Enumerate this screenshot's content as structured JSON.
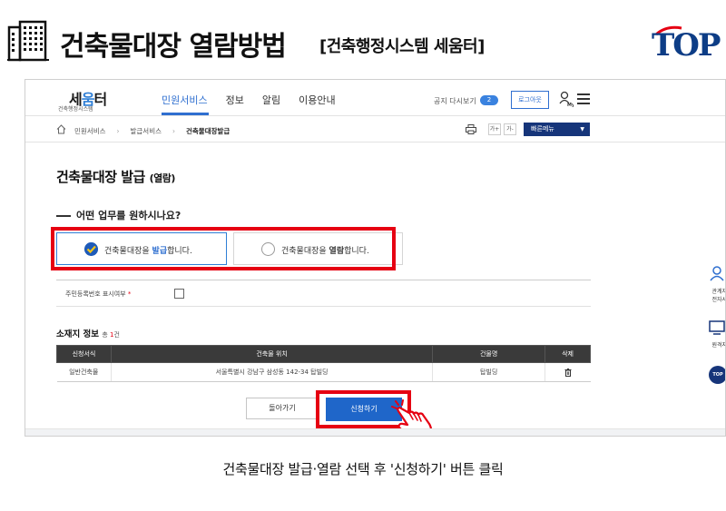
{
  "guide": {
    "title": "건축물대장 열람방법",
    "subtitle": "[건축행정시스템 세움터]",
    "brand": "TOP",
    "caption": "건축물대장 발급·열람 선택 후 '신청하기' 버튼 클릭"
  },
  "site": {
    "logo_main_a": "세",
    "logo_main_b": "움",
    "logo_main_c": "터",
    "logo_sub": "건축행정시스템",
    "menu": [
      "민원서비스",
      "정보",
      "알림",
      "이용안내"
    ],
    "notice_label": "공지 다시보기",
    "notice_count": "2",
    "logout_label": "로그아웃",
    "my_label": "My"
  },
  "breadcrumb": {
    "items": [
      "민원서비스",
      "발급서비스",
      "건축물대장발급"
    ],
    "font_up": "가+",
    "font_down": "가-",
    "quick_menu": "빠른메뉴"
  },
  "page": {
    "title": "건축물대장 발급",
    "title_suffix": "(열람)",
    "question": "어떤 업무를 원하시나요?",
    "options": [
      {
        "pre": "건축물대장을 ",
        "emph": "발급",
        "post": "합니다.",
        "selected": true
      },
      {
        "pre": "건축물대장을 ",
        "emph": "열람",
        "post": "합니다.",
        "selected": false
      }
    ],
    "rrn_label": "주민등록번호 표시여부",
    "rrn_req": "*",
    "location_title": "소재지 정보",
    "location_count_pre": "총 ",
    "location_count_num": "1",
    "location_count_post": "건"
  },
  "table": {
    "headers": [
      "신청서식",
      "건축물 위치",
      "건물명",
      "삭제"
    ],
    "rows": [
      {
        "form": "일반건축물",
        "address": "서울특별시 강남구 삼성동 142-34 탑빌딩",
        "name": "탑빌딩"
      }
    ]
  },
  "buttons": {
    "back": "돌아가기",
    "apply": "신청하기"
  },
  "side_panel": {
    "item1": "관계자",
    "item1b": "전자서",
    "item2": "원격지",
    "top": "TOP"
  },
  "colors": {
    "highlight": "#e60012",
    "primary": "#1f66c9",
    "navy": "#16357a"
  }
}
